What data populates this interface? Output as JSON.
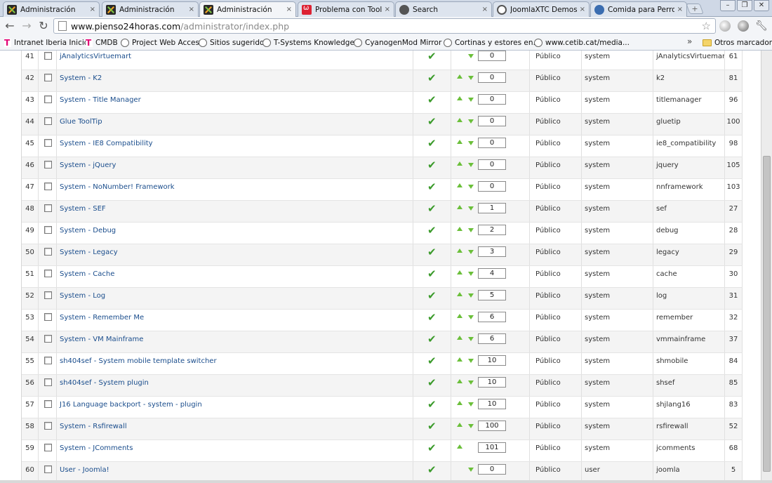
{
  "browser": {
    "tabs": [
      {
        "title": "Administración",
        "icon": "joomla-icon"
      },
      {
        "title": "Administración",
        "icon": "joomla-icon"
      },
      {
        "title": "Administración",
        "icon": "joomla-icon",
        "active": true
      },
      {
        "title": "Problema con ToolTips (",
        "icon": "omega-icon"
      },
      {
        "title": "Search",
        "icon": "gear-icon"
      },
      {
        "title": "JoomlaXTC Demos",
        "icon": "circle-icon"
      },
      {
        "title": "Comida para Perros y G",
        "icon": "globe-icon"
      }
    ],
    "tab_close": "×",
    "new_tab": "+",
    "window_controls": [
      "–",
      "❐",
      "✕"
    ],
    "url_host": "www.pienso24horas.com",
    "url_path": "/administrator/index.php",
    "bookmarks": [
      {
        "label": "Intranet Iberia Inicio",
        "icon": "t-logo-icon"
      },
      {
        "label": "CMDB",
        "icon": "t-logo-icon"
      },
      {
        "label": "Project Web Access",
        "icon": "globe-icon"
      },
      {
        "label": "Sitios sugeridos",
        "icon": "globe-icon"
      },
      {
        "label": "T-Systems Knowledge...",
        "icon": "globe-icon"
      },
      {
        "label": "CyanogenMod Mirror ...",
        "icon": "globe-icon"
      },
      {
        "label": "Cortinas y estores en...",
        "icon": "globe-icon"
      },
      {
        "label": "www.cetib.cat/media...",
        "icon": "globe-icon"
      }
    ],
    "bookmarks_more": "»",
    "other_bookmarks": "Otros marcadores"
  },
  "plugins": [
    {
      "num": "41",
      "name": "jAnalyticsVirtuemart",
      "order": "0",
      "access": "Público",
      "type": "system",
      "element": "jAnalyticsVirtuemart",
      "id": "61",
      "up": false,
      "down": true
    },
    {
      "num": "42",
      "name": "System - K2",
      "order": "0",
      "access": "Público",
      "type": "system",
      "element": "k2",
      "id": "81",
      "up": true,
      "down": true
    },
    {
      "num": "43",
      "name": "System - Title Manager",
      "order": "0",
      "access": "Público",
      "type": "system",
      "element": "titlemanager",
      "id": "96",
      "up": true,
      "down": true
    },
    {
      "num": "44",
      "name": "Glue ToolTip",
      "order": "0",
      "access": "Público",
      "type": "system",
      "element": "gluetip",
      "id": "100",
      "up": true,
      "down": true
    },
    {
      "num": "45",
      "name": "System - IE8 Compatibility",
      "order": "0",
      "access": "Público",
      "type": "system",
      "element": "ie8_compatibility",
      "id": "98",
      "up": true,
      "down": true
    },
    {
      "num": "46",
      "name": "System - jQuery",
      "order": "0",
      "access": "Público",
      "type": "system",
      "element": "jquery",
      "id": "105",
      "up": true,
      "down": true
    },
    {
      "num": "47",
      "name": "System - NoNumber! Framework",
      "order": "0",
      "access": "Público",
      "type": "system",
      "element": "nnframework",
      "id": "103",
      "up": true,
      "down": true
    },
    {
      "num": "48",
      "name": "System - SEF",
      "order": "1",
      "access": "Público",
      "type": "system",
      "element": "sef",
      "id": "27",
      "up": true,
      "down": true
    },
    {
      "num": "49",
      "name": "System - Debug",
      "order": "2",
      "access": "Público",
      "type": "system",
      "element": "debug",
      "id": "28",
      "up": true,
      "down": true
    },
    {
      "num": "50",
      "name": "System - Legacy",
      "order": "3",
      "access": "Público",
      "type": "system",
      "element": "legacy",
      "id": "29",
      "up": true,
      "down": true
    },
    {
      "num": "51",
      "name": "System - Cache",
      "order": "4",
      "access": "Público",
      "type": "system",
      "element": "cache",
      "id": "30",
      "up": true,
      "down": true
    },
    {
      "num": "52",
      "name": "System - Log",
      "order": "5",
      "access": "Público",
      "type": "system",
      "element": "log",
      "id": "31",
      "up": true,
      "down": true
    },
    {
      "num": "53",
      "name": "System - Remember Me",
      "order": "6",
      "access": "Público",
      "type": "system",
      "element": "remember",
      "id": "32",
      "up": true,
      "down": true
    },
    {
      "num": "54",
      "name": "System - VM Mainframe",
      "order": "6",
      "access": "Público",
      "type": "system",
      "element": "vmmainframe",
      "id": "37",
      "up": true,
      "down": true
    },
    {
      "num": "55",
      "name": "sh404sef - System mobile template switcher",
      "order": "10",
      "access": "Público",
      "type": "system",
      "element": "shmobile",
      "id": "84",
      "up": true,
      "down": true
    },
    {
      "num": "56",
      "name": "sh404sef - System plugin",
      "order": "10",
      "access": "Público",
      "type": "system",
      "element": "shsef",
      "id": "85",
      "up": true,
      "down": true
    },
    {
      "num": "57",
      "name": "J16 Language backport - system - plugin",
      "order": "10",
      "access": "Público",
      "type": "system",
      "element": "shjlang16",
      "id": "83",
      "up": true,
      "down": true
    },
    {
      "num": "58",
      "name": "System - Rsfirewall",
      "order": "100",
      "access": "Público",
      "type": "system",
      "element": "rsfirewall",
      "id": "52",
      "up": true,
      "down": true
    },
    {
      "num": "59",
      "name": "System - JComments",
      "order": "101",
      "access": "Público",
      "type": "system",
      "element": "jcomments",
      "id": "68",
      "up": true,
      "down": false
    },
    {
      "num": "60",
      "name": "User - Joomla!",
      "order": "0",
      "access": "Público",
      "type": "user",
      "element": "joomla",
      "id": "5",
      "up": false,
      "down": true
    }
  ],
  "colors": {
    "link": "#1a4d8c",
    "access": "#2e8b1e",
    "tick": "#3a9a2a",
    "arrow": "#6bbf3a"
  }
}
